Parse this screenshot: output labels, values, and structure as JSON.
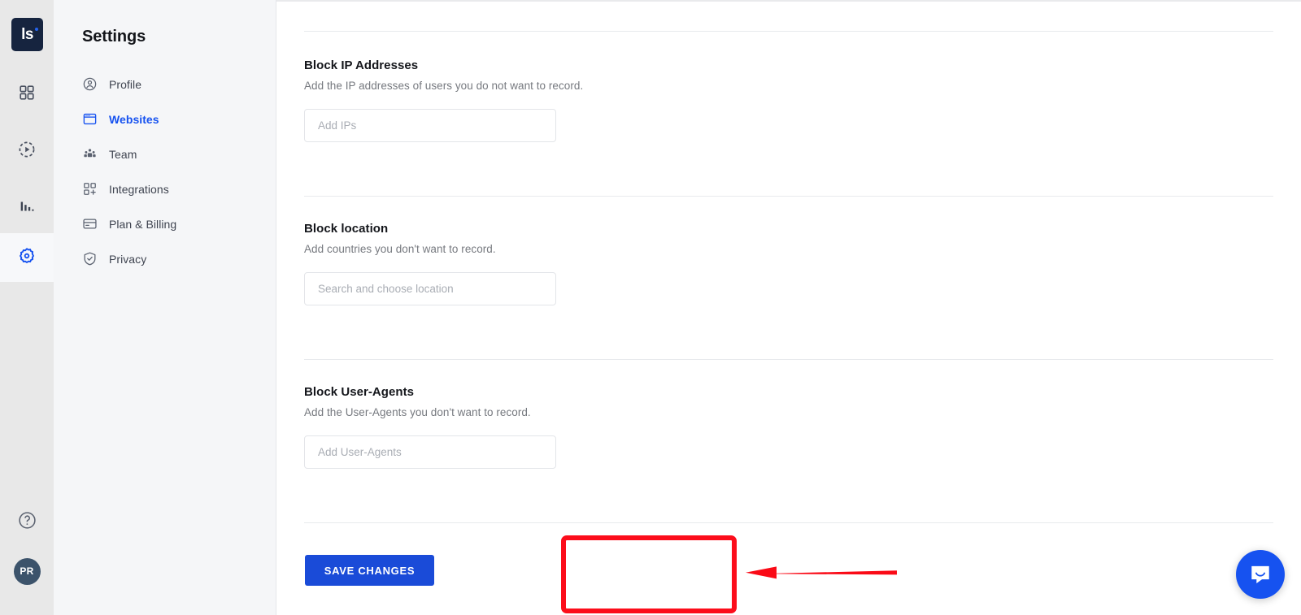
{
  "rail": {
    "logo": {
      "text": "ls",
      "name": "logo-mark",
      "bg": "#16243f",
      "dot_color": "#2563eb"
    },
    "items": [
      {
        "name": "dashboard-icon",
        "label": "Dashboard",
        "active": false
      },
      {
        "name": "recordings-icon",
        "label": "Recordings",
        "active": false
      },
      {
        "name": "analytics-icon",
        "label": "Analytics",
        "active": false
      },
      {
        "name": "settings-icon",
        "label": "Settings",
        "active": true
      }
    ],
    "help": {
      "name": "help-icon",
      "label": "Help"
    },
    "avatar": {
      "initials": "PR",
      "bg": "#3c536b"
    }
  },
  "sidebar": {
    "title": "Settings",
    "items": [
      {
        "label": "Profile",
        "icon": "profile-icon",
        "active": false
      },
      {
        "label": "Websites",
        "icon": "websites-icon",
        "active": true
      },
      {
        "label": "Team",
        "icon": "team-icon",
        "active": false
      },
      {
        "label": "Integrations",
        "icon": "integrations-icon",
        "active": false
      },
      {
        "label": "Plan & Billing",
        "icon": "billing-icon",
        "active": false
      },
      {
        "label": "Privacy",
        "icon": "privacy-icon",
        "active": false
      }
    ],
    "active_color": "#1652f0"
  },
  "main": {
    "sections": [
      {
        "title": "Block IP Addresses",
        "description": "Add the IP addresses of users you do not want to record.",
        "placeholder": "Add IPs",
        "value": ""
      },
      {
        "title": "Block location",
        "description": "Add countries you don't want to record.",
        "placeholder": "Search and choose location",
        "value": ""
      },
      {
        "title": "Block User-Agents",
        "description": "Add the User-Agents you don't want to record.",
        "placeholder": "Add User-Agents",
        "value": ""
      }
    ],
    "save_label": "SAVE CHANGES",
    "save_color": "#1a4bd8"
  },
  "annotations": {
    "highlight_color": "#fc0d1b",
    "target": "SAVE CHANGES"
  },
  "intercom": {
    "name": "intercom-launcher",
    "color": "#1652f0"
  }
}
